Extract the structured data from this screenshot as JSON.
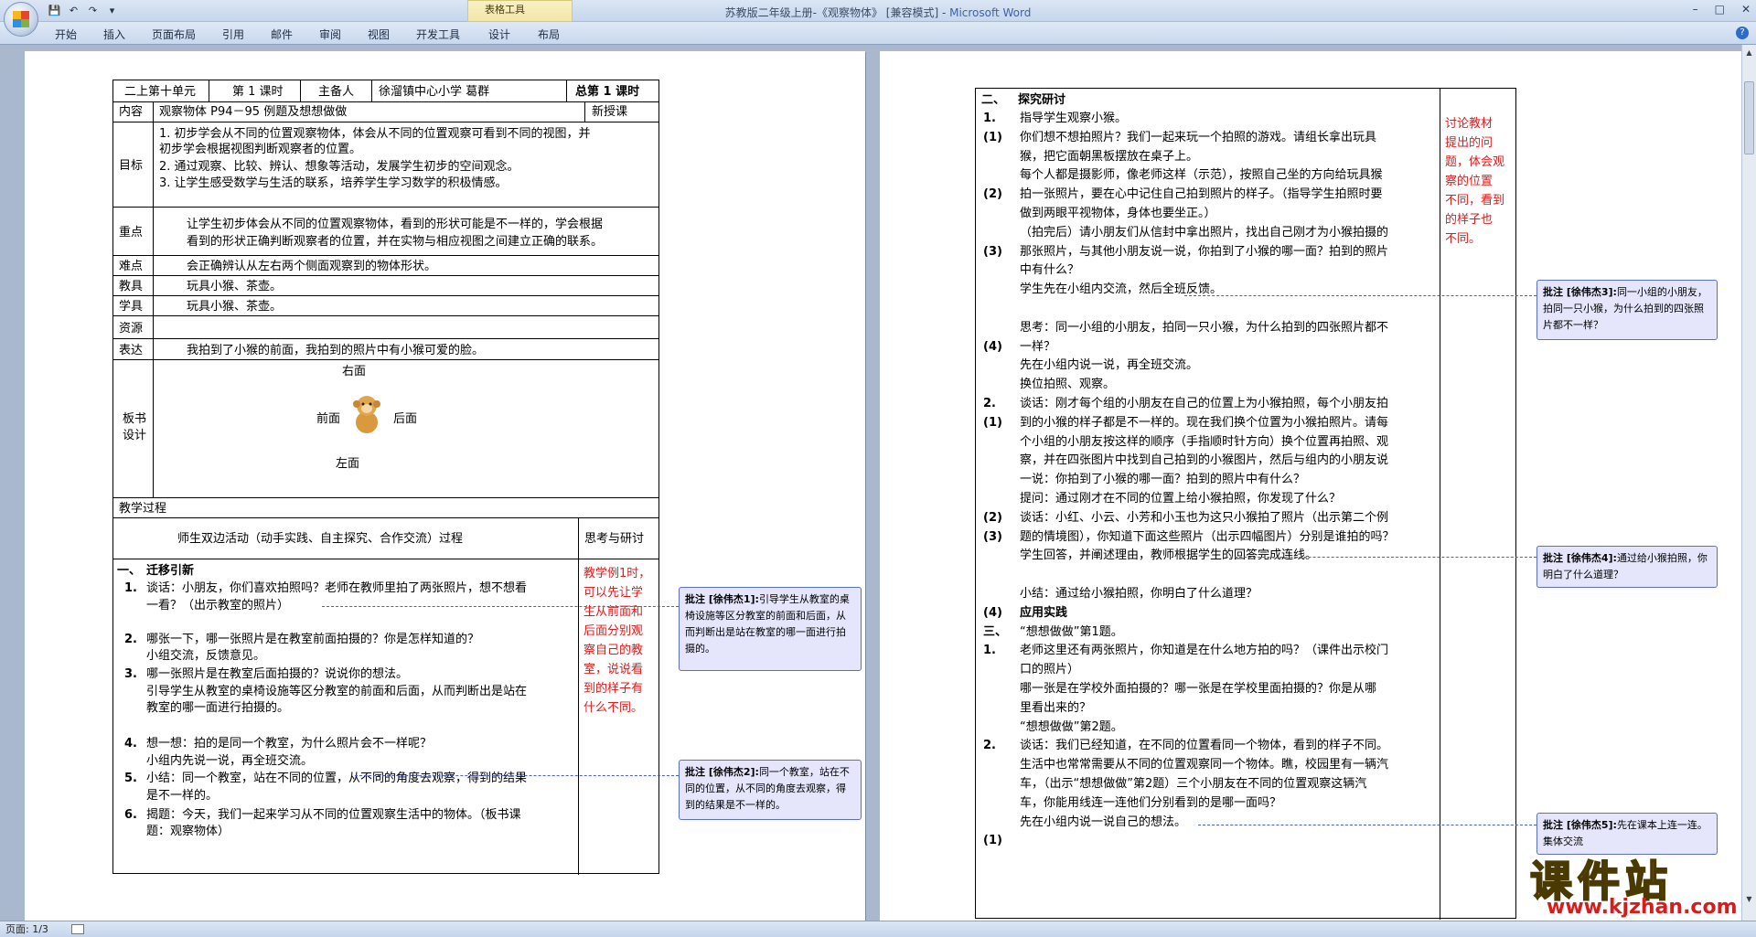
{
  "window": {
    "title_doc": "苏教版二年级上册-《观察物体》 [兼容模式] - ",
    "title_app": "Microsoft Word",
    "context_tab_group": "表格工具",
    "min_label": "–",
    "max_label": "□",
    "close_label": "✕"
  },
  "ribbon": {
    "tabs": [
      "开始",
      "插入",
      "页面布局",
      "引用",
      "邮件",
      "审阅",
      "视图",
      "开发工具",
      "设计",
      "布局"
    ]
  },
  "status": {
    "page_label": "页面: 1/3"
  },
  "page1": {
    "header": {
      "unit": "二上第十单元",
      "period": "第 1 课时",
      "host_label": "主备人",
      "host": "徐溜镇中心小学   葛群",
      "total": "总第 1 课时"
    },
    "content_label": "内容",
    "content": "观察物体   P94－95 例题及想想做做",
    "new_lesson": "新授课",
    "goal_label": "目标",
    "goals": [
      "1.   初步学会从不同的位置观察物体，体会从不同的位置观察可看到不同的视图，并",
      "      初步学会根据视图判断观察者的位置。",
      "2.   通过观察、比较、辨认、想象等活动，发展学生初步的空间观念。",
      "3.   让学生感受数学与生活的联系，培养学生学习数学的积极情感。"
    ],
    "key_label": "重点",
    "key": [
      "让学生初步体会从不同的位置观察物体，看到的形状可能是不一样的，学会根据",
      "看到的形状正确判断观察者的位置，并在实物与相应视图之间建立正确的联系。"
    ],
    "diff_label": "难点",
    "diff": "会正确辨认从左右两个侧面观察到的物体形状。",
    "tools_label": "教具",
    "tools": "玩具小猴、茶壶。",
    "stools_label": "学具",
    "stools": "玩具小猴、茶壶。",
    "res_label": "资源",
    "expr_label": "表达",
    "expr": "我拍到了小猴的前面，我拍到的照片中有小猴可爱的脸。",
    "board_label_1": "板书",
    "board_label_2": "设计",
    "board": {
      "top": "右面",
      "left": "前面",
      "right": "后面",
      "bottom": "左面"
    },
    "process_label": "教学过程",
    "col_activity": "师生双边活动（动手实践、自主探究、合作交流）过程",
    "col_think": "思考与研讨",
    "sec1_num": "一、",
    "sec1": "迁移引新",
    "items": [
      {
        "n": "1.",
        "lines": [
          "谈话：小朋友，你们喜欢拍照吗？老师在教师里拍了两张照片，想不想看",
          "一看？（出示教室的照片）"
        ]
      },
      {
        "n": "2.",
        "lines": [
          "哪张一下，哪一张照片是在教室前面拍摄的？你是怎样知道的？",
          "小组交流，反馈意见。"
        ]
      },
      {
        "n": "3.",
        "lines": [
          "哪一张照片是在教室后面拍摄的？说说你的想法。",
          "引导学生从教室的桌椅设施等区分教室的前面和后面，从而判断出是站在",
          "教室的哪一面进行拍摄的。"
        ]
      },
      {
        "n": "4.",
        "lines": [
          "想一想：拍的是同一个教室，为什么照片会不一样呢？",
          "小组内先说一说，再全班交流。"
        ]
      },
      {
        "n": "5.",
        "lines": [
          "小结：同一个教室，站在不同的位置，从不同的角度去观察，得到的结果",
          "是不一样的。"
        ]
      },
      {
        "n": "6.",
        "lines": [
          "揭题：今天，我们一起来学习从不同的位置观察生活中的物体。（板书课",
          "题：观察物体）"
        ]
      }
    ],
    "think_red": [
      "教学例1时，",
      "可以先让学",
      "生从前面和",
      "后面分别观",
      "察自己的教",
      "室，说说看",
      "到的样子有",
      "什么不同。"
    ]
  },
  "page2": {
    "sec2_num": "二、",
    "sec2": "探究研讨",
    "lines": [
      {
        "n": "1.",
        "t": "指导学生观察小猴。"
      },
      {
        "n": "(1)",
        "t": "你们想不想拍照片？我们一起来玩一个拍照的游戏。请组长拿出玩具"
      },
      {
        "n": "",
        "t": "猴，把它面朝黑板摆放在桌子上。"
      },
      {
        "n": "",
        "t": "每个人都是摄影师，像老师这样（示范），按照自己坐的方向给玩具猴"
      },
      {
        "n": "(2)",
        "t": "拍一张照片，要在心中记住自己拍到照片的样子。（指导学生拍照时要"
      },
      {
        "n": "",
        "t": "做到两眼平视物体，身体也要坐正。）"
      },
      {
        "n": "",
        "t": "（拍完后）请小朋友们从信封中拿出照片，找出自己刚才为小猴拍摄的"
      },
      {
        "n": "(3)",
        "t": "那张照片，与其他小朋友说一说，你拍到了小猴的哪一面？拍到的照片"
      },
      {
        "n": "",
        "t": "中有什么？"
      },
      {
        "n": "",
        "t": "学生先在小组内交流，然后全班反馈。"
      },
      {
        "n": "",
        "t": ""
      },
      {
        "n": "",
        "t": "思考：同一小组的小朋友，拍同一只小猴，为什么拍到的四张照片都不"
      },
      {
        "n": "(4)",
        "t": "一样？"
      },
      {
        "n": "",
        "t": "先在小组内说一说，再全班交流。"
      },
      {
        "n": "",
        "t": "换位拍照、观察。"
      },
      {
        "n": "2.",
        "t": "谈话：刚才每个组的小朋友在自己的位置上为小猴拍照，每个小朋友拍"
      },
      {
        "n": "(1)",
        "t": "到的小猴的样子都是不一样的。现在我们换个位置为小猴拍照片。请每"
      },
      {
        "n": "",
        "t": "个小组的小朋友按这样的顺序（手指顺时针方向）换个位置再拍照、观"
      },
      {
        "n": "",
        "t": "察，并在四张图片中找到自己拍到的小猴图片，然后与组内的小朋友说"
      },
      {
        "n": "",
        "t": "一说：你拍到了小猴的哪一面？拍到的照片中有什么？"
      },
      {
        "n": "",
        "t": "提问：通过刚才在不同的位置上给小猴拍照，你发现了什么？"
      },
      {
        "n": "(2)",
        "t": "谈话：小红、小云、小芳和小玉也为这只小猴拍了照片（出示第二个例"
      },
      {
        "n": "(3)",
        "t": "题的情境图），你知道下面这些照片（出示四幅图片）分别是谁拍的吗？"
      },
      {
        "n": "",
        "t": "学生回答，并阐述理由，教师根据学生的回答完成连线。"
      },
      {
        "n": "",
        "t": ""
      },
      {
        "n": "",
        "t": "小结：通过给小猴拍照，你明白了什么道理？"
      },
      {
        "n": "(4)",
        "t": "应用实践"
      },
      {
        "n": "三、",
        "t": "“想想做做”第1题。"
      },
      {
        "n": "1.",
        "t": "老师这里还有两张照片，你知道是在什么地方拍的吗？（课件出示校门"
      },
      {
        "n": "",
        "t": "口的照片）"
      },
      {
        "n": "",
        "t": "哪一张是在学校外面拍摄的？哪一张是在学校里面拍摄的？你是从哪"
      },
      {
        "n": "",
        "t": "里看出来的？"
      },
      {
        "n": "",
        "t": "“想想做做”第2题。"
      },
      {
        "n": "2.",
        "t": "谈话：我们已经知道，在不同的位置看同一个物体，看到的样子不同。"
      },
      {
        "n": "",
        "t": "生活中也常常需要从不同的位置观察同一个物体。瞧，校园里有一辆汽"
      },
      {
        "n": "",
        "t": "车，（出示“想想做做”第2题）三个小朋友在不同的位置观察这辆汽"
      },
      {
        "n": "",
        "t": "车，你能用线连一连他们分别看到的是哪一面吗？"
      },
      {
        "n": "",
        "t": "先在小组内说一说自己的想法。"
      },
      {
        "n": "(1)",
        "t": ""
      }
    ],
    "think_red": [
      "讨论教材",
      "提出的问",
      "题，体会观",
      "察的位置",
      "不同，看到",
      "的样子也",
      "不同。"
    ]
  },
  "comments": [
    {
      "author": "批注 [徐伟杰1]:",
      "text": "引导学生从教室的桌椅设施等区分教室的前面和后面，从而判断出是站在教室的哪一面进行拍摄的。"
    },
    {
      "author": "批注 [徐伟杰2]:",
      "text": "同一个教室，站在不同的位置，从不同的角度去观察，得到的结果是不一样的。"
    },
    {
      "author": "批注 [徐伟杰3]:",
      "text": "同一小组的小朋友，拍同一只小猴，为什么拍到的四张照片都不一样？"
    },
    {
      "author": "批注 [徐伟杰4]:",
      "text": "通过给小猴拍照，你明白了什么道理？"
    },
    {
      "author": "批注 [徐伟杰5]:",
      "text": "先在课本上连一连。集体交流"
    }
  ],
  "watermark": {
    "big": "课件站",
    "url": "www.kjzhan.com"
  }
}
